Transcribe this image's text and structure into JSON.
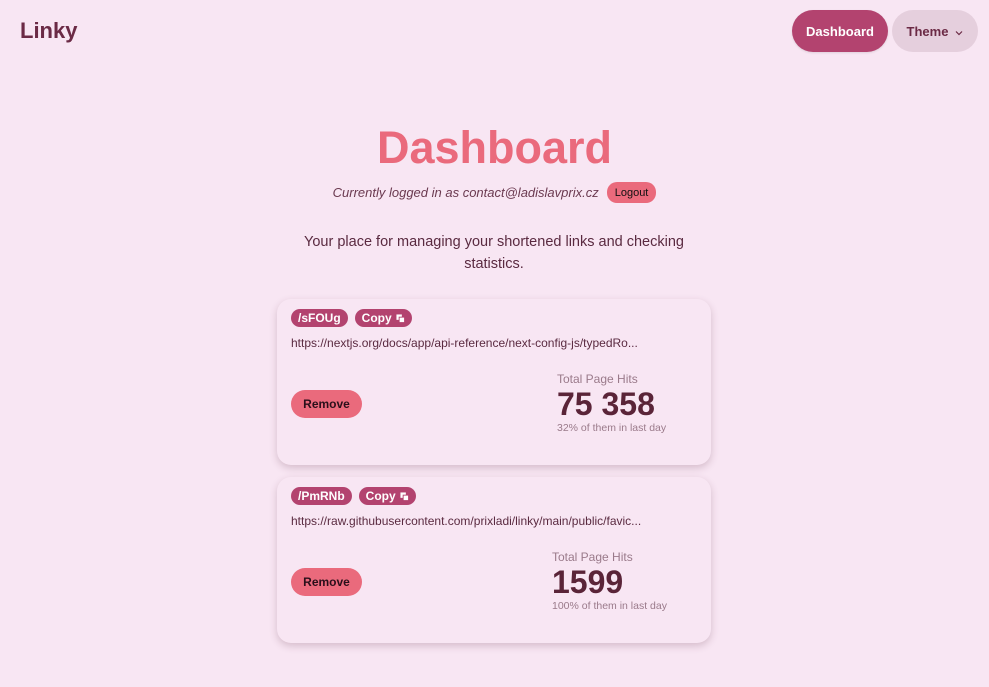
{
  "navbar": {
    "brand": "Linky",
    "dashboard_label": "Dashboard",
    "theme_label": "Theme",
    "theme_icon": "chevron-down-icon"
  },
  "hero": {
    "title": "Dashboard",
    "login_text": "Currently logged in as contact@ladislavprix.cz",
    "logout_label": "Logout",
    "tagline": "Your place for managing your shortened links and checking statistics."
  },
  "links": [
    {
      "slug": "/sFOUg",
      "copy_label": "Copy",
      "url": "https://nextjs.org/docs/app/api-reference/next-config-js/typedRo...",
      "remove_label": "Remove",
      "stat_title": "Total Page Hits",
      "stat_value": "75 358",
      "stat_desc": "32% of them in last day"
    },
    {
      "slug": "/PmRNb",
      "copy_label": "Copy",
      "url": "https://raw.githubusercontent.com/prixladi/linky/main/public/favic...",
      "remove_label": "Remove",
      "stat_title": "Total Page Hits",
      "stat_value": "1599",
      "stat_desc": "100% of them in last day"
    }
  ],
  "colors": {
    "background": "#f8e6f3",
    "primary": "#b3436f",
    "accent": "#ea6a7c",
    "text": "#5a2a40"
  }
}
